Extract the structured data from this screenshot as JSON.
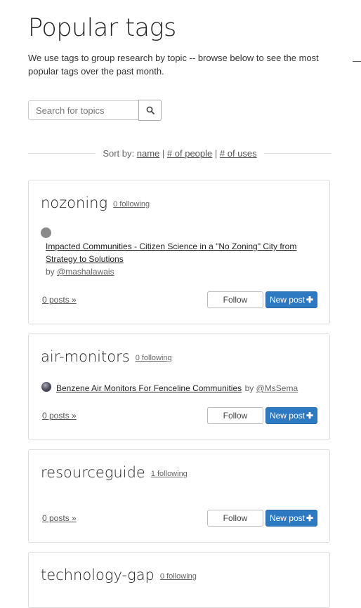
{
  "header": {
    "title": "Popular tags",
    "intro": "We use tags to group research by topic -- browse below to see the most popular tags over the past month."
  },
  "search": {
    "placeholder": "Search for topics",
    "icon": "search-icon"
  },
  "sort": {
    "prefix": "Sort by:",
    "options": [
      "name",
      "# of people",
      "# of uses"
    ],
    "sep": "|"
  },
  "tags": [
    {
      "name": "nozoning",
      "following": "0 following",
      "note_title": "Impacted Communities - Citizen Science in a \"No Zoning\" City from Strategy to Solutions",
      "by_prefix": "by",
      "author": "@mashalawais",
      "posts": "0 posts »",
      "follow": "Follow",
      "new_post": "New post"
    },
    {
      "name": "air-monitors",
      "following": "0 following",
      "note_title": "Benzene Air Monitors For Fenceline Communities",
      "by_prefix": "by",
      "author": "@MsSema",
      "posts": "0 posts »",
      "follow": "Follow",
      "new_post": "New post"
    },
    {
      "name": "resourceguide",
      "following": "1 following",
      "posts": "0 posts »",
      "follow": "Follow",
      "new_post": "New post"
    },
    {
      "name": "technology-gap",
      "following": "0 following"
    }
  ],
  "colors": {
    "primary_button": "#2e7ac2",
    "border": "#dddddd"
  }
}
